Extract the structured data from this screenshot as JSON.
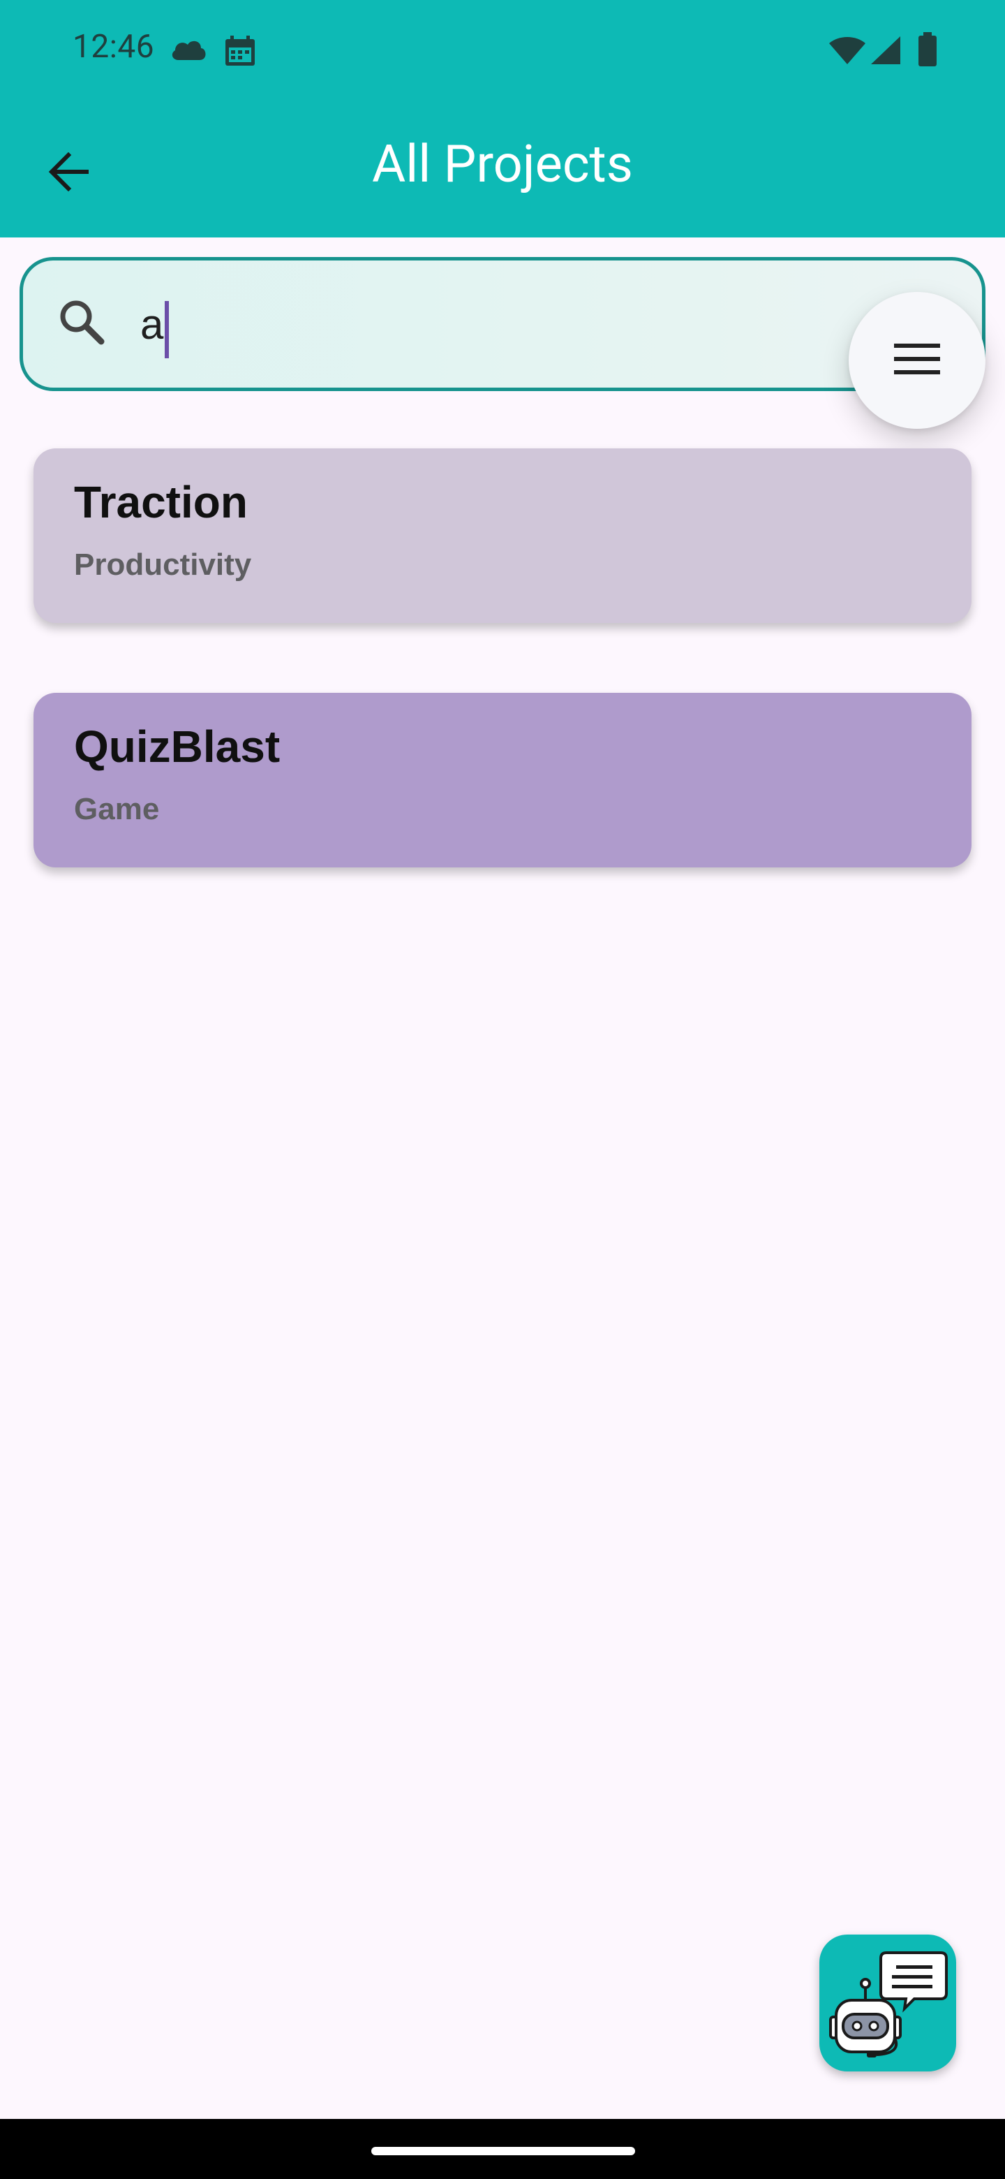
{
  "status_bar": {
    "time": "12:46",
    "left_icons": [
      "cloud-icon",
      "calendar-icon"
    ],
    "right_icons": [
      "wifi-icon",
      "signal-icon",
      "battery-icon"
    ]
  },
  "app_bar": {
    "title": "All Projects",
    "back_icon": "arrow-back-icon"
  },
  "search": {
    "value": "a",
    "icon": "search-icon"
  },
  "menu_button": {
    "icon": "menu-icon"
  },
  "projects": [
    {
      "title": "Traction",
      "category": "Productivity",
      "color": "#D0C6D9"
    },
    {
      "title": "QuizBlast",
      "category": "Game",
      "color": "#AF9BCC"
    }
  ],
  "chatbot_button": {
    "icon": "chatbot-icon"
  },
  "colors": {
    "primary": "#0DBAB5",
    "search_border": "#17938E",
    "background": "#FDF7FE",
    "caret": "#6B4EA8"
  }
}
